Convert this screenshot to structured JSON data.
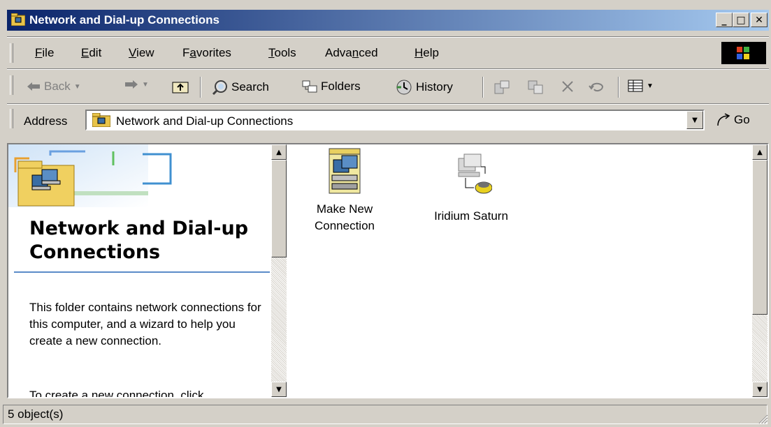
{
  "window": {
    "title": "Network and Dial-up Connections"
  },
  "titlebar_buttons": {
    "minimize": "_",
    "maximize": "□",
    "close": "✕"
  },
  "menu": [
    {
      "label": "File",
      "u": "F"
    },
    {
      "label": "Edit",
      "u": "E"
    },
    {
      "label": "View",
      "u": "V"
    },
    {
      "label": "Favorites",
      "u": "a"
    },
    {
      "label": "Tools",
      "u": "T"
    },
    {
      "label": "Advanced",
      "u": "n"
    },
    {
      "label": "Help",
      "u": "H"
    }
  ],
  "toolbar": {
    "back_label": "Back",
    "search_label": "Search",
    "folders_label": "Folders",
    "history_label": "History"
  },
  "address": {
    "label": "Address",
    "value": "Network and Dial-up Connections",
    "go_label": "Go"
  },
  "left_panel": {
    "title": "Network and Dial-up Connections",
    "description": "This folder contains network connections for this computer, and a wizard to help you create a new connection.",
    "description2": "To create a new connection, click"
  },
  "items": [
    {
      "label": "Make New Connection",
      "icon": "make-new-connection-icon"
    },
    {
      "label": "Iridium Saturn",
      "icon": "dialup-connection-icon"
    }
  ],
  "status": {
    "text": "5 object(s)"
  }
}
